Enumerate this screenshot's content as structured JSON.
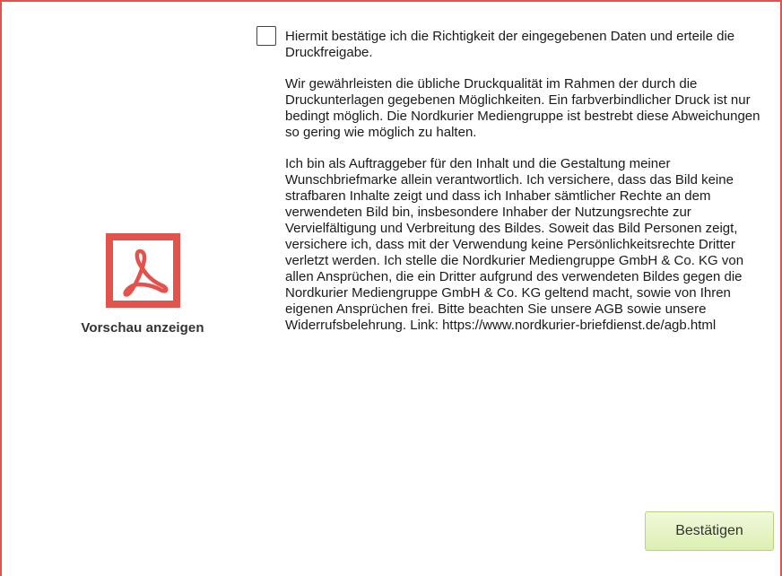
{
  "colors": {
    "frame_border": "#e2534d",
    "pdf_icon": "#e2534d",
    "button_bg": "#e4f3c2",
    "button_border": "#b9cf86"
  },
  "preview": {
    "icon": "pdf-icon",
    "label": "Vorschau anzeigen"
  },
  "agreement": {
    "checked": false,
    "checkbox_label": "Hiermit bestätige ich die Richtigkeit der eingegebenen Daten und erteile die Druckfreigabe.",
    "quality_text": "Wir gewährleisten die übliche Druckqualität im Rahmen der durch die Druckunterlagen gegebenen Möglichkeiten. Ein farbverbindlicher Druck ist nur bedingt möglich. Die Nordkurier Mediengruppe ist bestrebt diese Abweichungen so gering wie möglich zu halten.",
    "liability_text": "Ich bin als Auftraggeber für den Inhalt und die Gestaltung meiner Wunschbriefmarke allein verantwortlich. Ich versichere, dass das Bild keine strafbaren Inhalte zeigt und dass ich Inhaber sämtlicher Rechte an dem verwendeten Bild bin, insbesondere Inhaber der Nutzungsrechte zur Vervielfältigung und Verbreitung des Bildes. Soweit das Bild Personen zeigt, versichere ich, dass mit der Verwendung keine Persönlichkeitsrechte Dritter verletzt werden. Ich stelle die Nordkurier Mediengruppe GmbH & Co. KG von allen Ansprüchen, die ein Dritter aufgrund des verwendeten Bildes gegen die Nordkurier Mediengruppe GmbH & Co. KG geltend macht, sowie von Ihren eigenen Ansprüchen frei. Bitte beachten Sie unsere AGB sowie unsere Widerrufsbelehrung. Link: https://www.nordkurier-briefdienst.de/agb.html"
  },
  "actions": {
    "confirm_label": "Bestätigen"
  }
}
